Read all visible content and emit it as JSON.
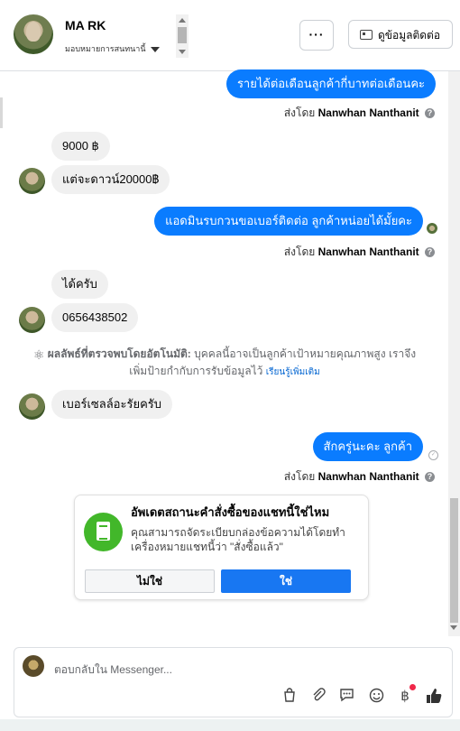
{
  "header": {
    "name": "MA RK",
    "assign_label": "มอบหมายการสนทนานี้",
    "more_label": "···",
    "contact_button": "ดูข้อมูลติดต่อ"
  },
  "messages": {
    "m1": "รายได้ต่อเดือนลูกค้ากี่บาทต่อเดือนคะ",
    "m2": "9000 ฿",
    "m3": "แต่จะดาวน์20000฿",
    "m4": "แอดมินรบกวนขอเบอร์ติดต่อ ลูกค้าหน่อยได้มั้ยคะ",
    "m5": "ได้ครับ",
    "m6": "0656438502",
    "m7": "เบอร์เซลล์อะรัยครับ",
    "m8": "สักครู่นะคะ ลูกค้า"
  },
  "sent_by": {
    "prefix": "ส่งโดย",
    "name": "Nanwhan Nanthanit"
  },
  "auto_detect": {
    "title": "ผลลัพธ์ที่ตรวจพบโดยอัตโนมัติ:",
    "text": "บุคคลนี้อาจเป็นลูกค้าเป้าหมายคุณภาพสูง เราจึง",
    "text2": "เพิ่มป้ายกำกับการรับข้อมูลไว้",
    "link": "เรียนรู้เพิ่มเติม"
  },
  "order_card": {
    "title": "อัพเดตสถานะคำสั่งซื้อของแชทนี้ใช่ไหม",
    "desc": "คุณสามารถจัดระเบียบกล่องข้อความได้โดยทำเครื่องหมายแชทนี้ว่า \"สั่งซื้อแล้ว\"",
    "no": "ไม่ใช่",
    "yes": "ใช่"
  },
  "composer": {
    "placeholder": "ตอบกลับใน Messenger..."
  },
  "toolbar_icons": [
    "bag-icon",
    "attach-icon",
    "saved-reply-icon",
    "emoji-icon",
    "baht-icon",
    "like-icon"
  ],
  "colors": {
    "accent_blue": "#0a7cff",
    "button_blue": "#1877f2",
    "success_green": "#42b72a"
  }
}
